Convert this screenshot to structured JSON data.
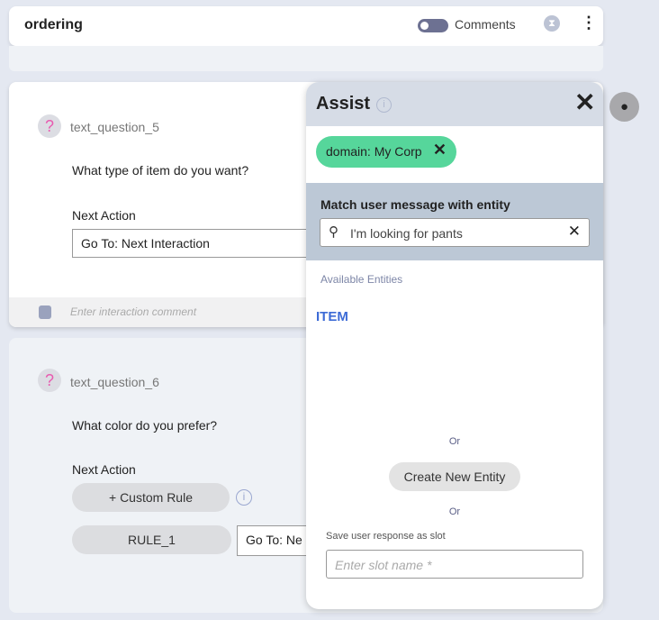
{
  "header": {
    "title": "ordering",
    "toggle_label": "Comments",
    "toggle_on": false
  },
  "cards": [
    {
      "id": "text_question_5",
      "question": "What type of item do you want?",
      "next_action_label": "Next Action",
      "select_value": "Go To:  Next Interaction",
      "comment_placeholder": "Enter interaction comment"
    },
    {
      "id": "text_question_6",
      "question": "What color do you prefer?",
      "next_action_label": "Next Action",
      "custom_rule": "+ Custom Rule",
      "rule": "RULE_1",
      "select_value": "Go To:  Ne"
    }
  ],
  "assist": {
    "title": "Assist",
    "chip": "domain: My Corp",
    "match_label": "Match user message with entity",
    "search_value": "I'm looking for pants",
    "available_label": "Available Entities",
    "entities": [
      "ITEM"
    ],
    "or1": "Or",
    "create_button": "Create New Entity",
    "or2": "Or",
    "slot_label": "Save user response as slot",
    "slot_placeholder": "Enter slot name *"
  },
  "colors": {
    "chip": "#56d69b",
    "entity": "#3d6bd6",
    "toggle": "#6d7192"
  }
}
